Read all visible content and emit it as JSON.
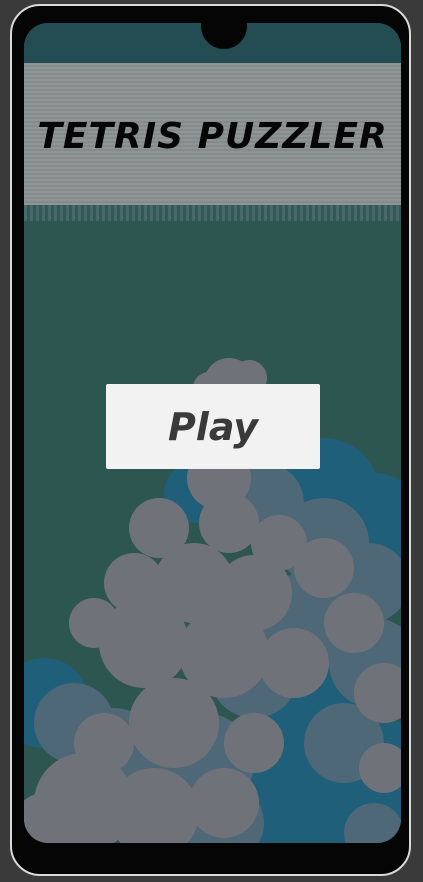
{
  "game": {
    "title": "TETRIS PUZZLER",
    "play_label": "Play"
  },
  "colors": {
    "device_frame": "#050505",
    "device_border": "#d9d9d9",
    "sky": "#2e5651",
    "title_bar": "#969696",
    "title_text": "#060606",
    "button_bg": "#f2f2f2",
    "button_text": "#3a3a3a",
    "cloud_light": "#6f7379",
    "cloud_mid": "#4e6878",
    "cloud_blue": "#1f5f7a"
  },
  "icons": [
    "front-camera-notch-icon",
    "cloud-background-icon"
  ]
}
